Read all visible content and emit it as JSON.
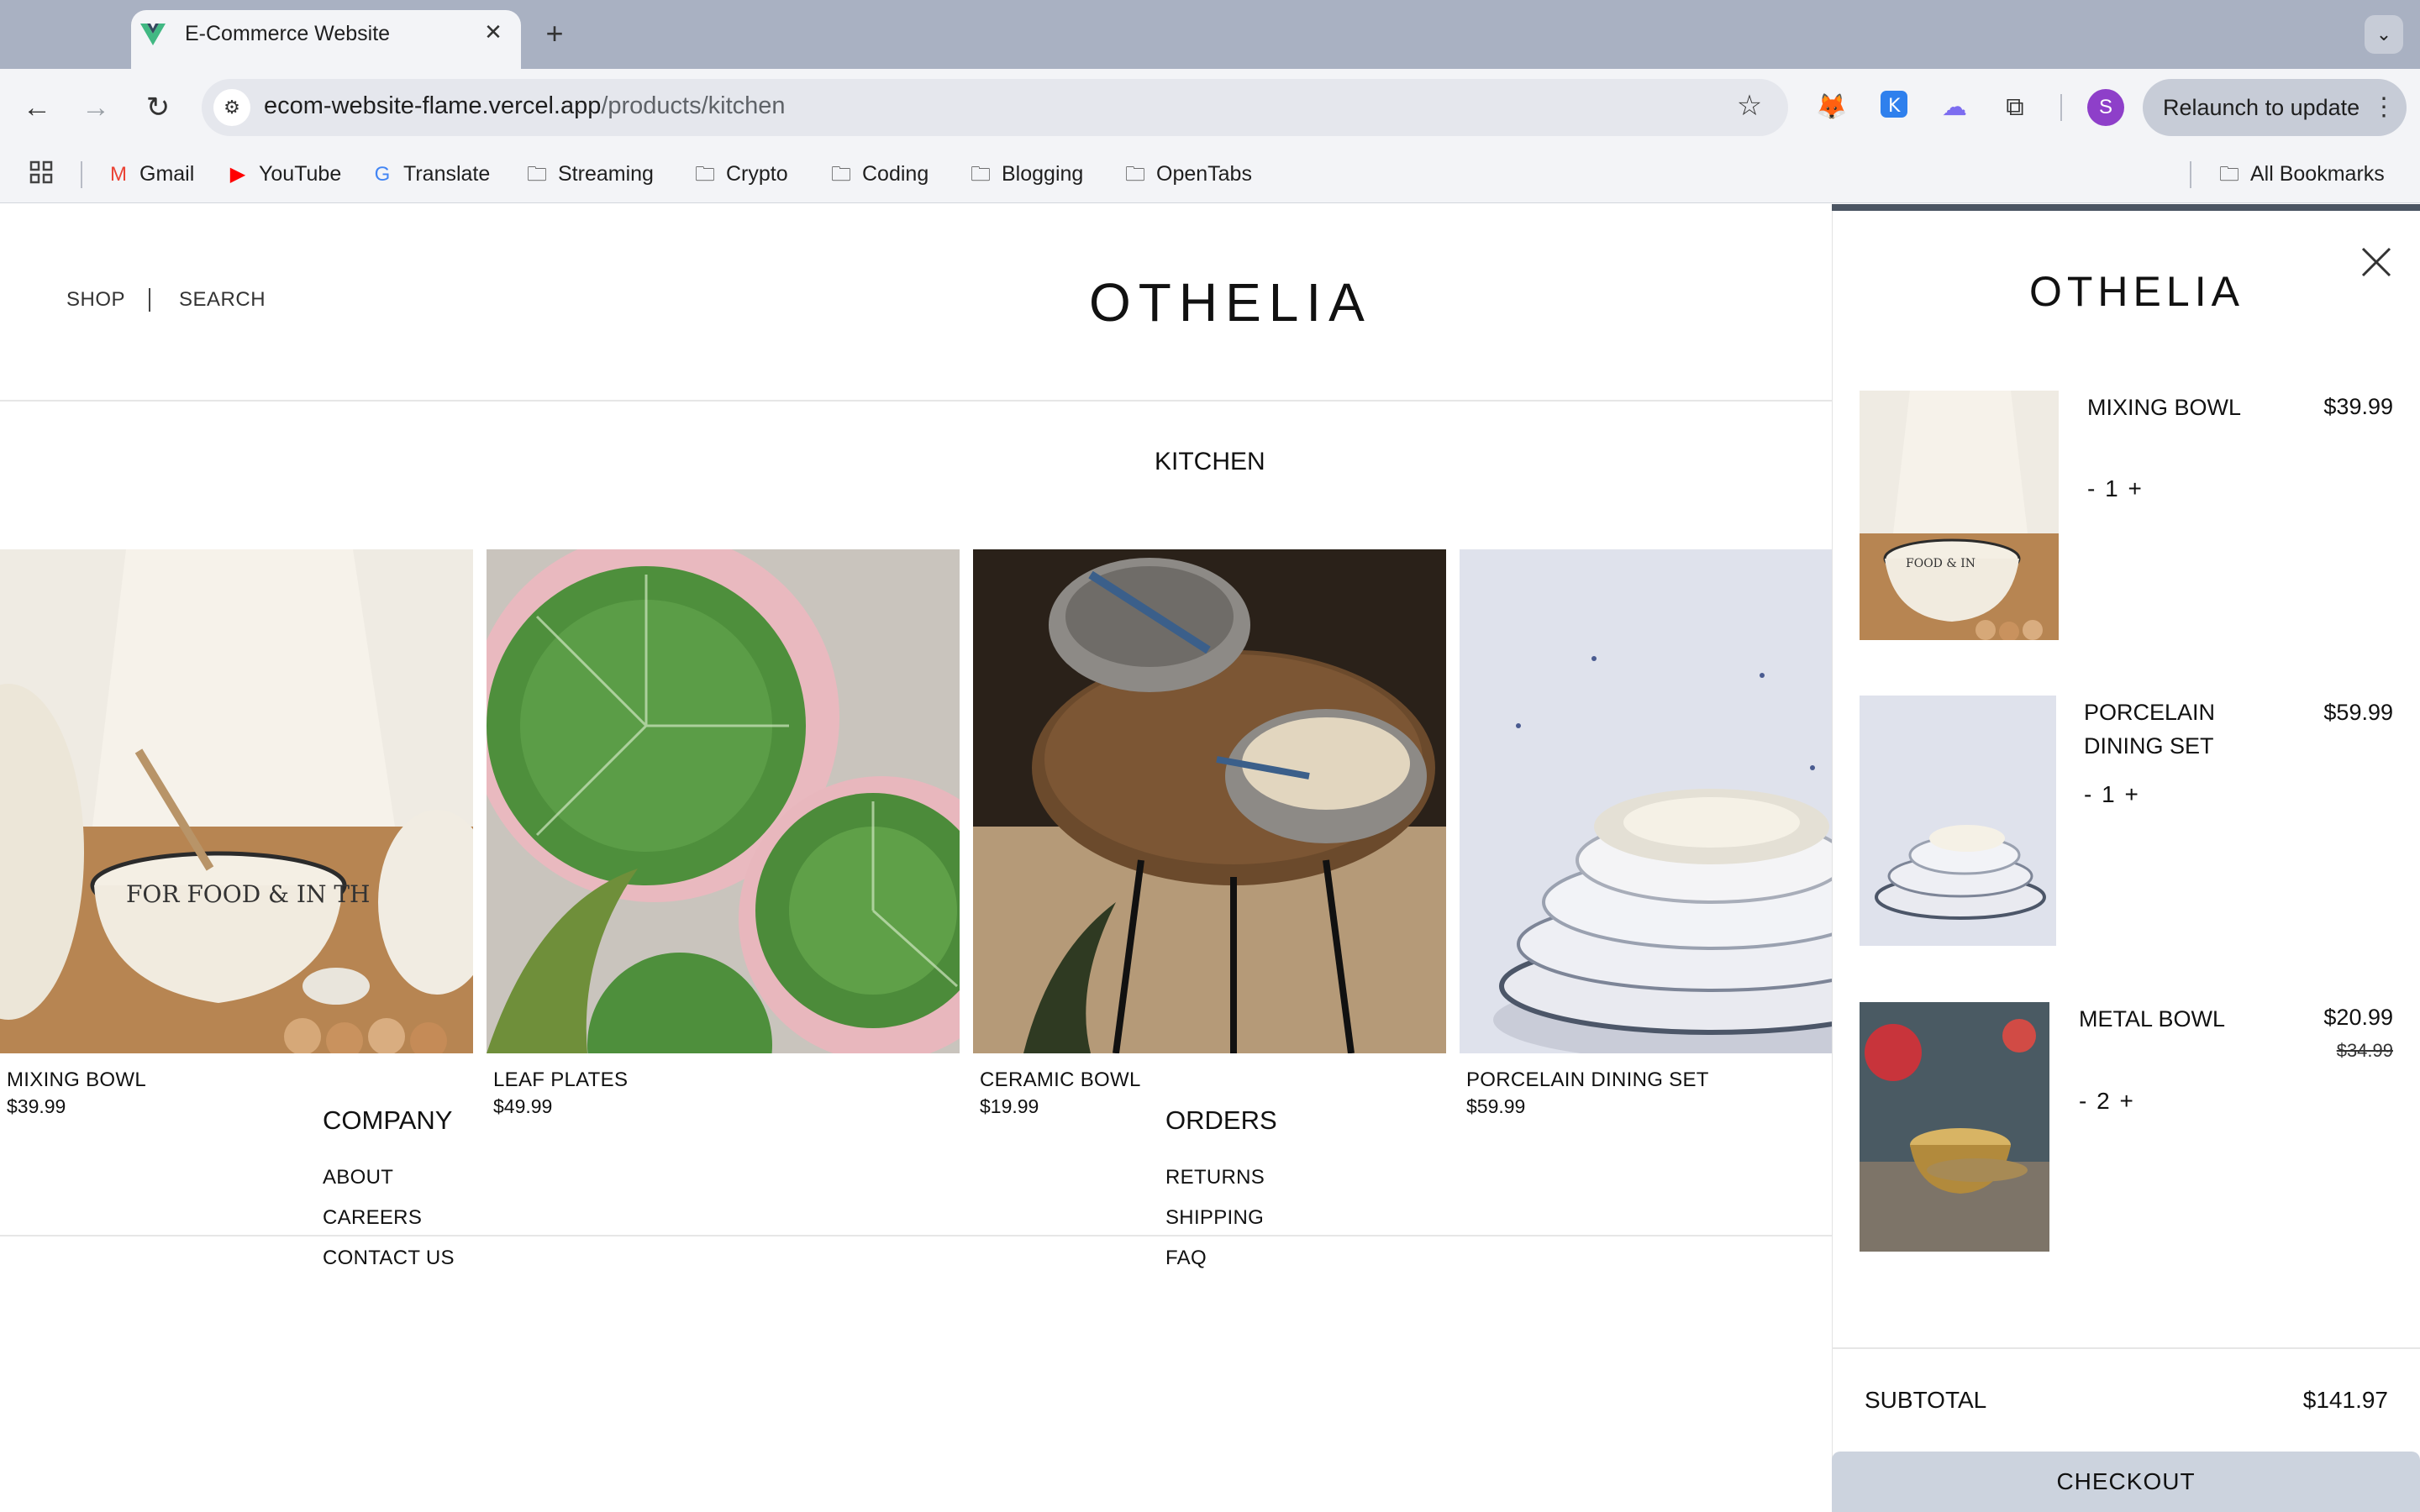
{
  "browser": {
    "tab_title": "E-Commerce Website",
    "tab_close": "✕",
    "new_tab": "+",
    "url_host": "ecom-website-flame.vercel.app",
    "url_path": "/products/kitchen",
    "relaunch_label": "Relaunch to update",
    "profile_initial": "S",
    "bookmarks": [
      {
        "label": "Gmail",
        "icon": "gmail-icon"
      },
      {
        "label": "YouTube",
        "icon": "youtube-icon"
      },
      {
        "label": "Translate",
        "icon": "translate-icon"
      },
      {
        "label": "Streaming",
        "icon": "folder-icon"
      },
      {
        "label": "Crypto",
        "icon": "folder-icon"
      },
      {
        "label": "Coding",
        "icon": "folder-icon"
      },
      {
        "label": "Blogging",
        "icon": "folder-icon"
      },
      {
        "label": "OpenTabs",
        "icon": "folder-icon"
      }
    ],
    "all_bookmarks": "All Bookmarks"
  },
  "header": {
    "shop": "SHOP",
    "search": "SEARCH",
    "logo": "OTHELIA"
  },
  "category": {
    "title": "KITCHEN"
  },
  "products": [
    {
      "name": "MIXING BOWL",
      "price": "$39.99"
    },
    {
      "name": "LEAF PLATES",
      "price": "$49.99"
    },
    {
      "name": "CERAMIC BOWL",
      "price": "$19.99"
    },
    {
      "name": "PORCELAIN DINING SET",
      "price": "$59.99"
    }
  ],
  "footer": {
    "company": {
      "heading": "COMPANY",
      "links": [
        "ABOUT",
        "CAREERS",
        "CONTACT US"
      ]
    },
    "orders": {
      "heading": "ORDERS",
      "links": [
        "RETURNS",
        "SHIPPING",
        "FAQ"
      ]
    }
  },
  "cart": {
    "logo": "OTHELIA",
    "items": [
      {
        "name": "MIXING BOWL",
        "price": "$39.99",
        "old_price": "",
        "qty": "- 1 +"
      },
      {
        "name": "PORCELAIN DINING SET",
        "price": "$59.99",
        "old_price": "",
        "qty": "- 1 +"
      },
      {
        "name": "METAL BOWL",
        "price": "$20.99",
        "old_price": "$34.99",
        "qty": "- 2 +"
      }
    ],
    "subtotal_label": "SUBTOTAL",
    "subtotal_value": "$141.97",
    "checkout_label": "CHECKOUT"
  },
  "colors": {
    "tabstrip": "#a9b1c2",
    "chrome": "#f3f4f7",
    "checkout_bg": "#ccd3de",
    "drawer_bar": "#4b5563"
  }
}
